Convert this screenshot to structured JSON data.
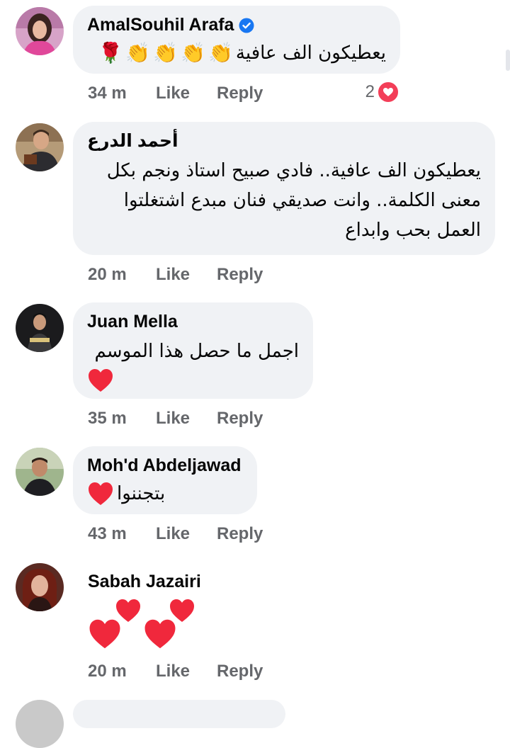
{
  "colors": {
    "bubble": "#f0f2f5",
    "meta_text": "#65676b",
    "verified_blue": "#1877f2",
    "heart_red": "#f0283c",
    "reaction_heart": "#f33e58"
  },
  "comments": [
    {
      "author": "AmalSouhil Arafa",
      "verified": true,
      "text": "يعطيكون الف عافية",
      "emojis": [
        "rose-icon",
        "clapping-hands-icon",
        "clapping-hands-icon",
        "clapping-hands-icon",
        "clapping-hands-icon"
      ],
      "time": "34 m",
      "like": "Like",
      "reply": "Reply",
      "reaction_count": "2",
      "reaction_icon": "heart-reaction-icon"
    },
    {
      "author": "أحمد الدرع",
      "text_lines": [
        "يعطيكون الف عافية.. فادي صبيح استاذ ونجم بكل",
        "معنى الكلمة.. وانت صديقي فنان مبدع اشتغلتوا",
        "العمل بحب وابداع"
      ],
      "time": "20 m",
      "like": "Like",
      "reply": "Reply"
    },
    {
      "author": "Juan Mella",
      "text": "اجمل ما حصل هذا الموسم",
      "emojis": [
        "red-heart-icon"
      ],
      "time": "35 m",
      "like": "Like",
      "reply": "Reply"
    },
    {
      "author": "Moh'd Abdeljawad",
      "text": "بتجننوا",
      "emojis": [
        "red-heart-icon"
      ],
      "time": "43 m",
      "like": "Like",
      "reply": "Reply"
    },
    {
      "author": "Sabah Jazairi",
      "emojis": [
        "red-heart-icon",
        "red-heart-icon",
        "red-heart-icon",
        "red-heart-icon"
      ],
      "time": "20 m",
      "like": "Like",
      "reply": "Reply"
    }
  ]
}
